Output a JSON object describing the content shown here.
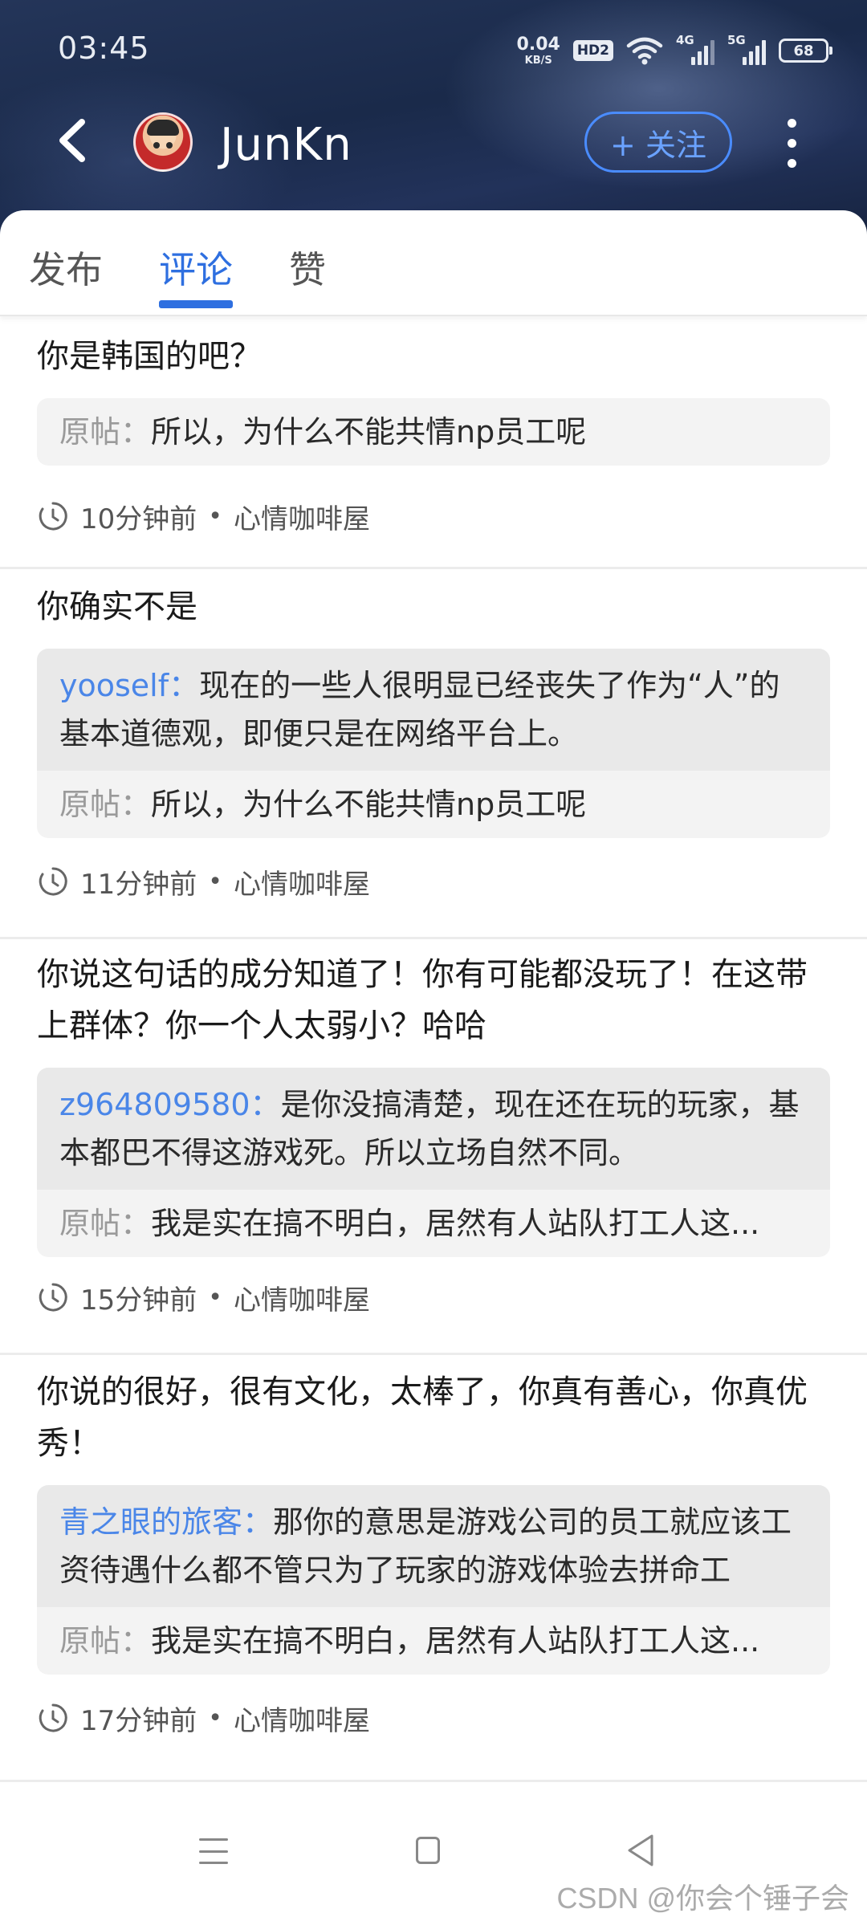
{
  "status_bar": {
    "time": "03:45",
    "net_speed_value": "0.04",
    "net_speed_unit": "KB/S",
    "hd_label": "HD2",
    "sim1_label": "4G",
    "sim2_label": "5G",
    "battery": "68"
  },
  "header": {
    "username": "JunKn",
    "follow_label": "+ 关注"
  },
  "tabs": [
    {
      "label": "发布"
    },
    {
      "label": "评论",
      "active": true
    },
    {
      "label": "赞"
    }
  ],
  "comments": [
    {
      "text": "你是韩国的吧？",
      "orig_label": "原帖：",
      "orig_text": "所以，为什么不能共情np员工呢",
      "time": "10分钟前",
      "board": "心情咖啡屋"
    },
    {
      "text": "你确实不是",
      "reply_user": "yooself：",
      "reply_text": "现在的一些人很明显已经丧失了作为“人”的基本道德观，即便只是在网络平台上。",
      "orig_label": "原帖：",
      "orig_text": "所以，为什么不能共情np员工呢",
      "time": "11分钟前",
      "board": "心情咖啡屋"
    },
    {
      "text": "你说这句话的成分知道了！你有可能都没玩了！在这带上群体？你一个人太弱小？哈哈",
      "reply_user": "z964809580：",
      "reply_text": "是你没搞清楚，现在还在玩的玩家，基本都巴不得这游戏死。所以立场自然不同。",
      "orig_label": "原帖：",
      "orig_text": "我是实在搞不明白，居然有人站队打工人这...",
      "time": "15分钟前",
      "board": "心情咖啡屋"
    },
    {
      "text": "你说的很好，很有文化，太棒了，你真有善心，你真优秀！",
      "reply_user": "青之眼的旅客：",
      "reply_text": "那你的意思是游戏公司的员工就应该工资待遇什么都不管只为了玩家的游戏体验去拼命工",
      "orig_label": "原帖：",
      "orig_text": "我是实在搞不明白，居然有人站队打工人这...",
      "time": "17分钟前",
      "board": "心情咖啡屋"
    }
  ],
  "meta_separator": "•",
  "watermark": "CSDN @你会个锤子会"
}
